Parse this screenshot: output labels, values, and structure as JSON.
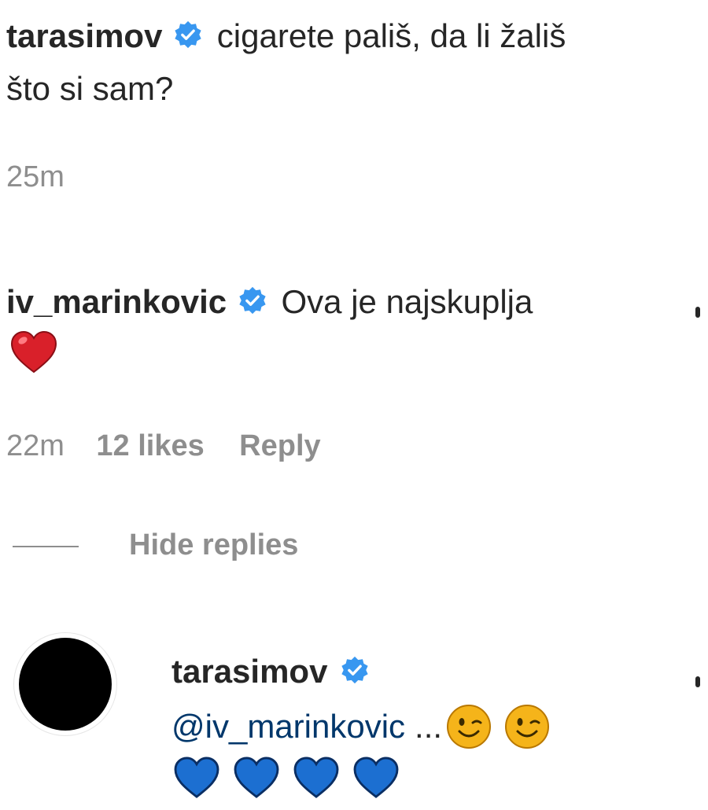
{
  "comments": [
    {
      "username": "tarasimov",
      "text_line1": "cigarete pališ, da li žališ",
      "text_line2": "što si sam?",
      "time": "25m"
    },
    {
      "username": "iv_marinkovic",
      "text": "Ova je najskuplja",
      "time": "22m",
      "likes": "12 likes",
      "reply_label": "Reply",
      "hide_replies_label": "Hide replies"
    }
  ],
  "reply": {
    "username": "tarasimov",
    "mention": "@iv_marinkovic",
    "ellipsis": "..."
  },
  "colors": {
    "verified": "#3897f0",
    "heart_red": "#d9202a",
    "heart_blue": "#1c6fd1",
    "emoji_yellow": "#f5b41a",
    "muted": "#8e8e8e",
    "mention": "#00376b"
  },
  "icons": [
    "verified-badge-icon",
    "red-heart-icon",
    "winking-face-icon",
    "blue-heart-icon",
    "more-options-icon",
    "avatar"
  ]
}
